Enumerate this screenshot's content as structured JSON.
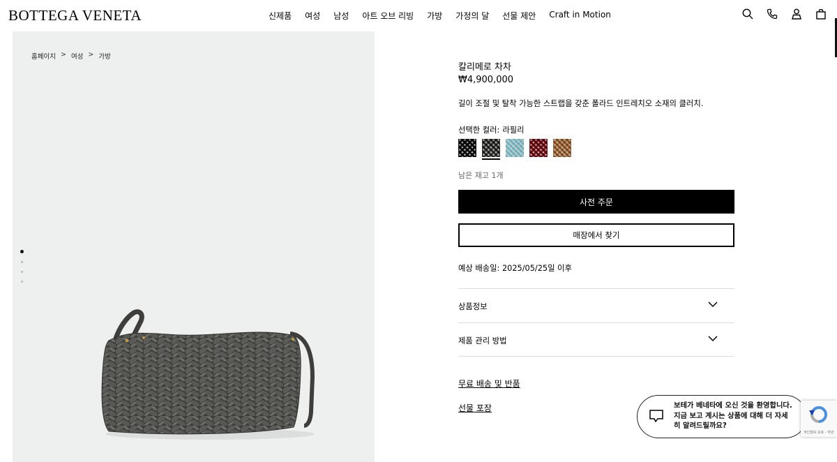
{
  "header": {
    "logo": "BOTTEGA VENETA",
    "nav": [
      "신제품",
      "여성",
      "남성",
      "아트 오브 리빙",
      "가방",
      "가정의 달",
      "선물 제안",
      "Craft in Motion"
    ],
    "icons": [
      "search-icon",
      "phone-icon",
      "account-icon",
      "bag-icon"
    ]
  },
  "breadcrumb": [
    "홈페이지",
    "여성",
    "가방"
  ],
  "breadcrumb_sep": ">",
  "product": {
    "name": "칼리메로 차차",
    "price": "₩4,900,000",
    "description": "길이 조절 및 탈착 가능한 스트랩을 갖춘 폴라드 인트레치오 소재의 클러치.",
    "color_label": "선택한 컬러:",
    "color_value": "라필리",
    "swatches": [
      {
        "name": "black",
        "color": "#1a1a1a",
        "selected": false
      },
      {
        "name": "lapilli",
        "color": "#4a4a48",
        "selected": true
      },
      {
        "name": "light-blue",
        "color": "#a9d9e0",
        "selected": false
      },
      {
        "name": "red",
        "color": "#8e1a22",
        "selected": false
      },
      {
        "name": "tan",
        "color": "#b5814b",
        "selected": false
      }
    ],
    "stock": "남은 재고 1개",
    "preorder_label": "사전 주문",
    "store_label": "매장에서 찾기",
    "ship_date": "예상 배송일: 2025/05/25일 이후"
  },
  "accordion": [
    {
      "label": "상품정보"
    },
    {
      "label": "제품 관리 방법"
    }
  ],
  "links": [
    "무료 배송 및 반품",
    "선물 포장"
  ],
  "chat": {
    "message": "보테가 베네타에 오신 것을 환영합니다.\n지금 보고 계시는 상품에 대해 더 자세\n히 알려드릴까요?"
  },
  "recaptcha_text": "개인정보 보호 - 약관",
  "gallery": {
    "slides": 4,
    "active_slide": 1
  }
}
